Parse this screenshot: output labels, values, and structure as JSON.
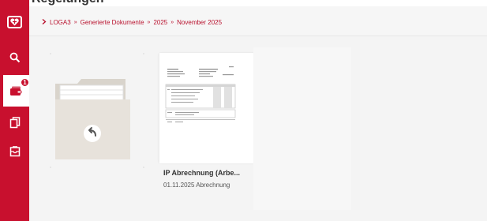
{
  "window": {
    "cut_title": "Regelungen"
  },
  "sidebar": {
    "items": [
      {
        "name": "app-logo",
        "icon": "heart-logo-icon"
      },
      {
        "name": "search",
        "icon": "search-icon"
      },
      {
        "name": "documents",
        "icon": "wallet-icon",
        "badge": "1"
      },
      {
        "name": "copy",
        "icon": "documents-icon"
      },
      {
        "name": "inbox",
        "icon": "inbox-icon"
      }
    ],
    "color": "#c8102e"
  },
  "breadcrumb": {
    "items": [
      "LOGA3",
      "Generierte Dokumente",
      "2025",
      "November 2025"
    ],
    "separator": "»"
  },
  "tiles": {
    "back_folder": {
      "icon": "back-arrow-icon"
    },
    "document": {
      "title": "IP Abrechnung (Arbe...",
      "subtitle": "01.11.2025 Abrechnung"
    }
  }
}
